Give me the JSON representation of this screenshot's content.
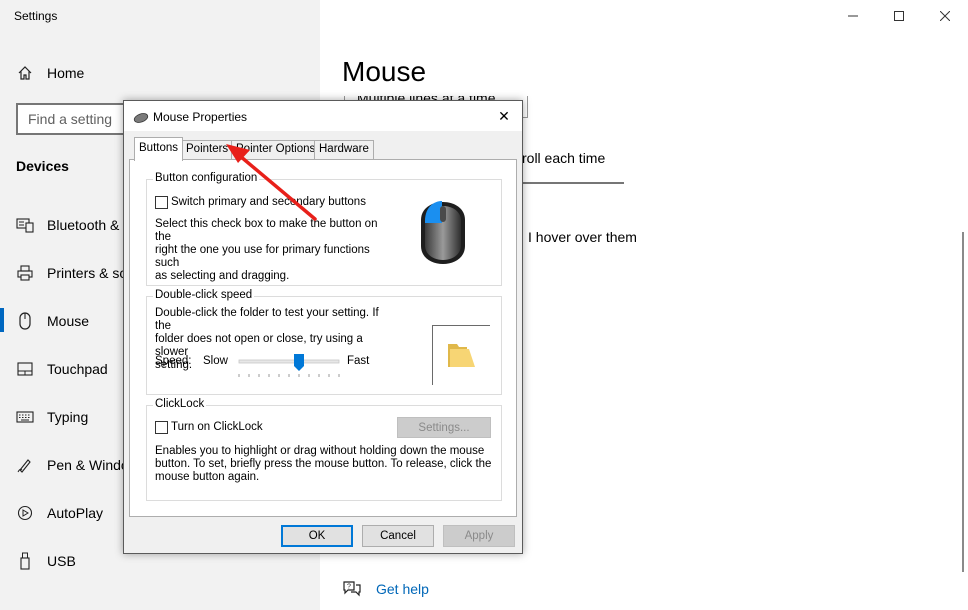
{
  "window": {
    "title": "Settings"
  },
  "sidebar": {
    "home": {
      "label": "Home",
      "icon": "home-icon"
    },
    "search_placeholder": "Find a setting",
    "section_title": "Devices",
    "items": [
      {
        "label": "Bluetooth & ",
        "icon": "bluetooth-icon"
      },
      {
        "label": "Printers & sc",
        "icon": "printer-icon"
      },
      {
        "label": "Mouse",
        "icon": "mouse-icon",
        "selected": true
      },
      {
        "label": "Touchpad",
        "icon": "touchpad-icon"
      },
      {
        "label": "Typing",
        "icon": "keyboard-icon"
      },
      {
        "label": "Pen & Windo",
        "icon": "pen-icon"
      },
      {
        "label": "AutoPlay",
        "icon": "autoplay-icon"
      },
      {
        "label": "USB",
        "icon": "usb-icon"
      }
    ]
  },
  "main": {
    "title": "Mouse",
    "obscured_dropdown_text": "Multiple lines at a time",
    "bg_text1": "roll each time",
    "bg_text2": "I hover over them",
    "get_help": "Get help"
  },
  "dialog": {
    "title": "Mouse Properties",
    "close": "✕",
    "tabs": [
      "Buttons",
      "Pointers",
      "Pointer Options",
      "Hardware"
    ],
    "active_tab": "Buttons",
    "button_config": {
      "label": "Button configuration",
      "checkbox_label": "Switch primary and secondary buttons",
      "checked": false,
      "description_lines": [
        "Select this check box to make the button on the",
        "right the one you use for primary functions such",
        "as selecting and dragging."
      ]
    },
    "double_click": {
      "label": "Double-click speed",
      "description_lines": [
        "Double-click the folder to test your setting. If the",
        "folder does not open or close, try using a slower",
        "setting."
      ],
      "speed_label": "Speed:",
      "slow": "Slow",
      "fast": "Fast",
      "slider_value": 0.6
    },
    "clicklock": {
      "label": "ClickLock",
      "checkbox_label": "Turn on ClickLock",
      "checked": false,
      "settings_button": "Settings...",
      "description_lines": [
        "Enables you to highlight or drag without holding down the mouse",
        "button. To set, briefly press the mouse button. To release, click the",
        "mouse button again."
      ]
    },
    "buttons": {
      "ok": "OK",
      "cancel": "Cancel",
      "apply": "Apply"
    }
  },
  "colors": {
    "accent": "#0067c0",
    "arrow": "#e8201a",
    "link": "#0067b8"
  }
}
